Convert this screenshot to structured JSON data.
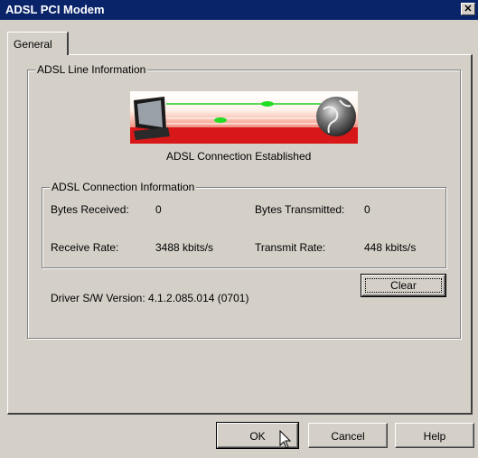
{
  "window": {
    "title": "ADSL PCI Modem",
    "close_glyph": "✕"
  },
  "tabs": [
    {
      "label": "General"
    }
  ],
  "line_info": {
    "group_label": "ADSL Line Information",
    "status": "ADSL Connection Established"
  },
  "connection_info": {
    "group_label": "ADSL Connection Information",
    "bytes_received_label": "Bytes Received:",
    "bytes_received_value": "0",
    "bytes_transmitted_label": "Bytes Transmitted:",
    "bytes_transmitted_value": "0",
    "receive_rate_label": "Receive Rate:",
    "receive_rate_value": "3488 kbits/s",
    "transmit_rate_label": "Transmit Rate:",
    "transmit_rate_value": "448 kbits/s"
  },
  "clear_button": "Clear",
  "driver_version": "Driver S/W Version: 4.1.2.085.014 (0701)",
  "buttons": {
    "ok": "OK",
    "cancel": "Cancel",
    "help": "Help"
  },
  "colors": {
    "titlebar": "#0a246a",
    "face": "#d4d0c8",
    "status_red": "#d81818",
    "status_green": "#22cc22"
  }
}
